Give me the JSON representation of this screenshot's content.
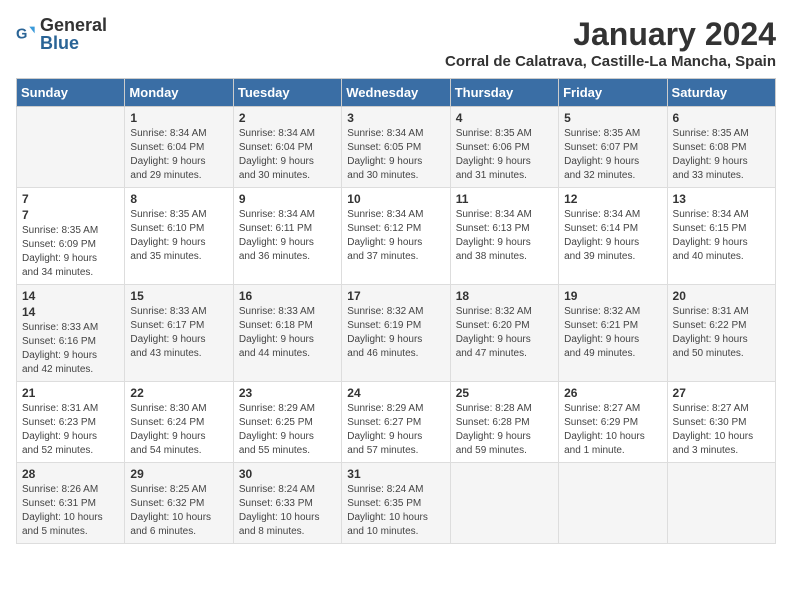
{
  "header": {
    "logo_general": "General",
    "logo_blue": "Blue",
    "month_title": "January 2024",
    "location": "Corral de Calatrava, Castille-La Mancha, Spain"
  },
  "days_of_week": [
    "Sunday",
    "Monday",
    "Tuesday",
    "Wednesday",
    "Thursday",
    "Friday",
    "Saturday"
  ],
  "weeks": [
    [
      {
        "day": "",
        "info": ""
      },
      {
        "day": "1",
        "info": "Sunrise: 8:34 AM\nSunset: 6:04 PM\nDaylight: 9 hours\nand 29 minutes."
      },
      {
        "day": "2",
        "info": "Sunrise: 8:34 AM\nSunset: 6:04 PM\nDaylight: 9 hours\nand 30 minutes."
      },
      {
        "day": "3",
        "info": "Sunrise: 8:34 AM\nSunset: 6:05 PM\nDaylight: 9 hours\nand 30 minutes."
      },
      {
        "day": "4",
        "info": "Sunrise: 8:35 AM\nSunset: 6:06 PM\nDaylight: 9 hours\nand 31 minutes."
      },
      {
        "day": "5",
        "info": "Sunrise: 8:35 AM\nSunset: 6:07 PM\nDaylight: 9 hours\nand 32 minutes."
      },
      {
        "day": "6",
        "info": "Sunrise: 8:35 AM\nSunset: 6:08 PM\nDaylight: 9 hours\nand 33 minutes."
      }
    ],
    [
      {
        "day": "7",
        "info": ""
      },
      {
        "day": "8",
        "info": "Sunrise: 8:35 AM\nSunset: 6:10 PM\nDaylight: 9 hours\nand 35 minutes."
      },
      {
        "day": "9",
        "info": "Sunrise: 8:34 AM\nSunset: 6:11 PM\nDaylight: 9 hours\nand 36 minutes."
      },
      {
        "day": "10",
        "info": "Sunrise: 8:34 AM\nSunset: 6:12 PM\nDaylight: 9 hours\nand 37 minutes."
      },
      {
        "day": "11",
        "info": "Sunrise: 8:34 AM\nSunset: 6:13 PM\nDaylight: 9 hours\nand 38 minutes."
      },
      {
        "day": "12",
        "info": "Sunrise: 8:34 AM\nSunset: 6:14 PM\nDaylight: 9 hours\nand 39 minutes."
      },
      {
        "day": "13",
        "info": "Sunrise: 8:34 AM\nSunset: 6:15 PM\nDaylight: 9 hours\nand 40 minutes."
      }
    ],
    [
      {
        "day": "14",
        "info": ""
      },
      {
        "day": "15",
        "info": "Sunrise: 8:33 AM\nSunset: 6:17 PM\nDaylight: 9 hours\nand 43 minutes."
      },
      {
        "day": "16",
        "info": "Sunrise: 8:33 AM\nSunset: 6:18 PM\nDaylight: 9 hours\nand 44 minutes."
      },
      {
        "day": "17",
        "info": "Sunrise: 8:32 AM\nSunset: 6:19 PM\nDaylight: 9 hours\nand 46 minutes."
      },
      {
        "day": "18",
        "info": "Sunrise: 8:32 AM\nSunset: 6:20 PM\nDaylight: 9 hours\nand 47 minutes."
      },
      {
        "day": "19",
        "info": "Sunrise: 8:32 AM\nSunset: 6:21 PM\nDaylight: 9 hours\nand 49 minutes."
      },
      {
        "day": "20",
        "info": "Sunrise: 8:31 AM\nSunset: 6:22 PM\nDaylight: 9 hours\nand 50 minutes."
      }
    ],
    [
      {
        "day": "21",
        "info": "Sunrise: 8:31 AM\nSunset: 6:23 PM\nDaylight: 9 hours\nand 52 minutes."
      },
      {
        "day": "22",
        "info": "Sunrise: 8:30 AM\nSunset: 6:24 PM\nDaylight: 9 hours\nand 54 minutes."
      },
      {
        "day": "23",
        "info": "Sunrise: 8:29 AM\nSunset: 6:25 PM\nDaylight: 9 hours\nand 55 minutes."
      },
      {
        "day": "24",
        "info": "Sunrise: 8:29 AM\nSunset: 6:27 PM\nDaylight: 9 hours\nand 57 minutes."
      },
      {
        "day": "25",
        "info": "Sunrise: 8:28 AM\nSunset: 6:28 PM\nDaylight: 9 hours\nand 59 minutes."
      },
      {
        "day": "26",
        "info": "Sunrise: 8:27 AM\nSunset: 6:29 PM\nDaylight: 10 hours\nand 1 minute."
      },
      {
        "day": "27",
        "info": "Sunrise: 8:27 AM\nSunset: 6:30 PM\nDaylight: 10 hours\nand 3 minutes."
      }
    ],
    [
      {
        "day": "28",
        "info": "Sunrise: 8:26 AM\nSunset: 6:31 PM\nDaylight: 10 hours\nand 5 minutes."
      },
      {
        "day": "29",
        "info": "Sunrise: 8:25 AM\nSunset: 6:32 PM\nDaylight: 10 hours\nand 6 minutes."
      },
      {
        "day": "30",
        "info": "Sunrise: 8:24 AM\nSunset: 6:33 PM\nDaylight: 10 hours\nand 8 minutes."
      },
      {
        "day": "31",
        "info": "Sunrise: 8:24 AM\nSunset: 6:35 PM\nDaylight: 10 hours\nand 10 minutes."
      },
      {
        "day": "",
        "info": ""
      },
      {
        "day": "",
        "info": ""
      },
      {
        "day": "",
        "info": ""
      }
    ]
  ]
}
